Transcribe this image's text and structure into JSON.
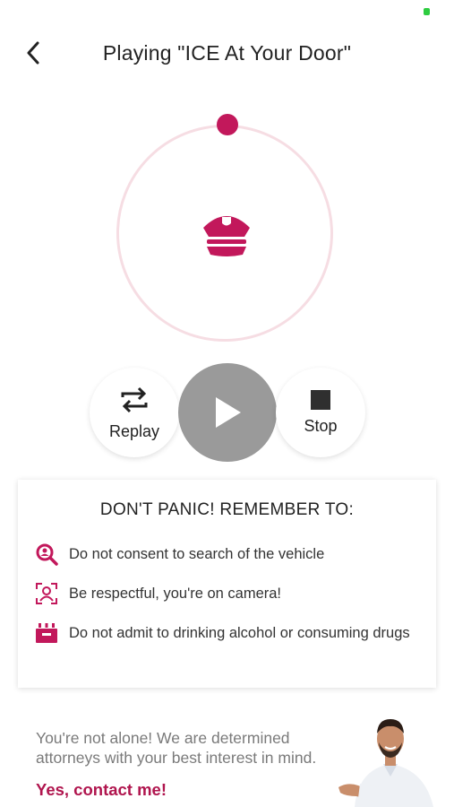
{
  "header": {
    "title": "Playing \"ICE At Your Door\"",
    "back_icon": "chevron-left-icon"
  },
  "player": {
    "center_icon": "police-officer-cap-icon",
    "progress": 0.0,
    "replay_label": "Replay",
    "stop_label": "Stop",
    "play_icon": "play-icon",
    "accent_color": "#c2185b",
    "ring_color": "#f6dde3"
  },
  "tips": {
    "heading": "DON'T PANIC! REMEMBER TO:",
    "items": [
      {
        "icon": "search-person-icon",
        "text": "Do not consent to search of the vehicle"
      },
      {
        "icon": "camera-person-icon",
        "text": "Be respectful, you're on camera!"
      },
      {
        "icon": "drinks-box-icon",
        "text": "Do not admit to drinking alcohol or consuming drugs"
      }
    ]
  },
  "promo": {
    "text": "You're not alone! We are determined attorneys with your best interest in mind.",
    "cta": "Yes, contact me!",
    "cta_color": "#b0154e"
  }
}
